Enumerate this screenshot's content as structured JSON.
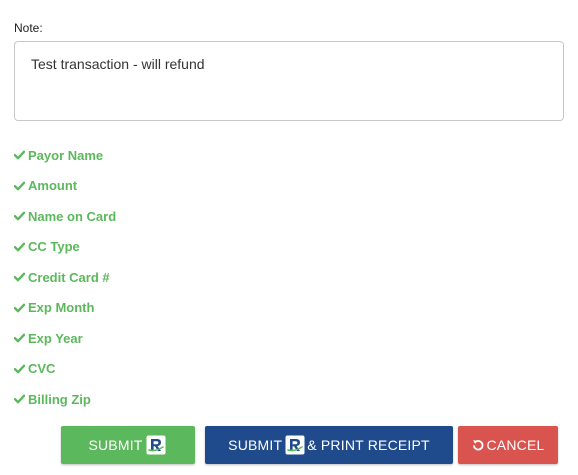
{
  "note": {
    "label": "Note:",
    "value": "Test transaction - will refund"
  },
  "checklist": {
    "items": [
      {
        "label": "Payor Name",
        "icon": "check-icon"
      },
      {
        "label": "Amount",
        "icon": "check-icon"
      },
      {
        "label": "Name on Card",
        "icon": "check-icon"
      },
      {
        "label": "CC Type",
        "icon": "check-icon"
      },
      {
        "label": "Credit Card #",
        "icon": "check-icon"
      },
      {
        "label": "Exp Month",
        "icon": "check-icon"
      },
      {
        "label": "Exp Year",
        "icon": "check-icon"
      },
      {
        "label": "CVC",
        "icon": "check-icon"
      },
      {
        "label": "Billing Zip",
        "icon": "check-icon"
      }
    ]
  },
  "buttons": {
    "submit_label": "SUBMIT",
    "print_prefix": "SUBMIT",
    "print_suffix": "& PRINT RECEIPT",
    "cancel_label": "CANCEL"
  },
  "colors": {
    "success": "#5cb85c",
    "primary": "#1f4a8c",
    "danger": "#d9534f"
  }
}
